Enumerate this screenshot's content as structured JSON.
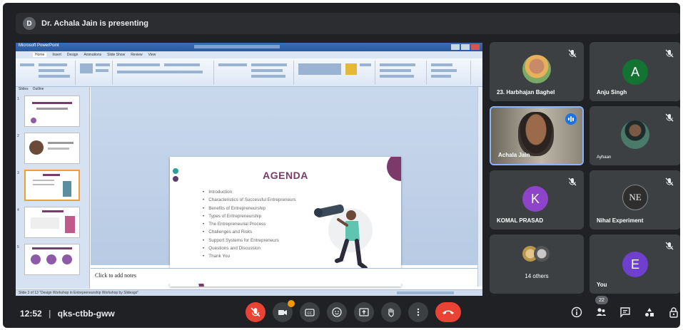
{
  "banner": {
    "avatar_letter": "D",
    "text": "Dr. Achala Jain is presenting"
  },
  "shared_screen": {
    "app_title": "Microsoft PowerPoint",
    "ribbon_tabs": [
      "Home",
      "Insert",
      "Design",
      "Animations",
      "Slide Show",
      "Review",
      "View"
    ],
    "left_panel_tabs": [
      "Slides",
      "Outline"
    ],
    "slide_numbers": [
      "1",
      "2",
      "3",
      "4",
      "5"
    ],
    "notes_placeholder": "Click to add notes",
    "status_text": "Slide 3 of 13   \"Design Workshop in Entrepreneurship Workshop by Slidesgo\"",
    "slide": {
      "title": "AGENDA",
      "items": [
        "Introduction",
        "Characteristics of Successful Entrepreneurs",
        "Benefits of Entrepreneurship",
        "Types of Entrepreneurship",
        "The Entrepreneurial Process",
        "Challenges and Risks",
        "Support Systems for Entrepreneurs",
        "Questions and Discussion",
        "Thank You"
      ]
    }
  },
  "participants": [
    {
      "name": "23. Harbhajan Baghel",
      "type": "photo",
      "muted": true
    },
    {
      "name": "Anju Singh",
      "type": "letter",
      "letter": "A",
      "color": "#137333",
      "muted": true
    },
    {
      "name": "Achala Jain",
      "type": "video",
      "speaking": true
    },
    {
      "name": "Ayhaan",
      "type": "photo",
      "muted": true
    },
    {
      "name": "KOMAL PRASAD",
      "type": "letter",
      "letter": "K",
      "color": "#8e44c9",
      "muted": true
    },
    {
      "name": "Nihal Experiment",
      "type": "photo",
      "initials": "NE",
      "muted": true
    },
    {
      "name": "14 others",
      "type": "group"
    },
    {
      "name": "You",
      "type": "letter",
      "letter": "E",
      "color": "#6f3fcf",
      "muted": true
    }
  ],
  "bottom_bar": {
    "time": "12:52",
    "separator": "|",
    "meeting_code": "qks-ctbb-gww",
    "controls": [
      "mic-off-icon",
      "camera-icon",
      "captions-icon",
      "emoji-icon",
      "present-icon",
      "raise-hand-icon",
      "more-icon",
      "end-call-icon"
    ],
    "right_controls": [
      "info-icon",
      "people-icon",
      "chat-icon",
      "activities-icon",
      "host-controls-icon"
    ],
    "participant_count": "22"
  },
  "colors": {
    "meet_bg": "#202124",
    "tile_bg": "#3c4043",
    "accent_blue": "#1a73e8",
    "end_call_red": "#ea4335",
    "slide_title": "#7b3a6a"
  }
}
